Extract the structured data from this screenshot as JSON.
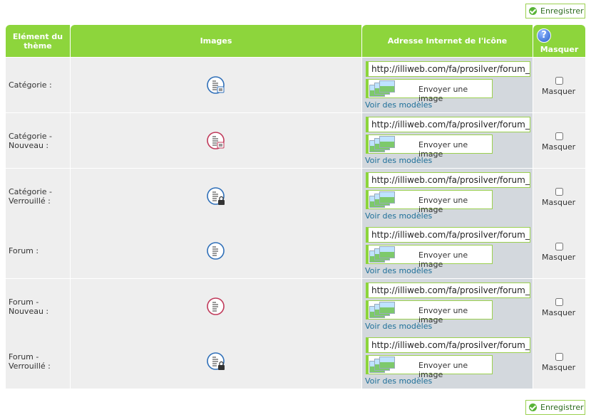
{
  "actions": {
    "save_label": "Enregistrer"
  },
  "headers": {
    "element": "Elément du thème",
    "images": "Images",
    "url": "Adresse Internet de l'icône",
    "hide": "Masquer"
  },
  "common": {
    "upload_label": "Envoyer une image",
    "models_link": "Voir des modèles",
    "hide_label": "Masquer"
  },
  "colors": {
    "header_bg": "#8dd53c",
    "blue_icon": "#2f6fb8",
    "red_icon": "#c0395a"
  },
  "rows": [
    {
      "label": "Catégorie :",
      "url": "http://illiweb.com/fa/prosilver/forum_read.gif",
      "icon": "category-read-icon",
      "tone": "blue",
      "badge": "page"
    },
    {
      "label": "Catégorie - Nouveau :",
      "url": "http://illiweb.com/fa/prosilver/forum_unread.gif",
      "icon": "category-new-icon",
      "tone": "red",
      "badge": "page"
    },
    {
      "label": "Catégorie - Verrouillé :",
      "url": "http://illiweb.com/fa/prosilver/forum_read_locked.gif",
      "icon": "category-locked-icon",
      "tone": "blue",
      "badge": "lock"
    },
    {
      "label": "Forum :",
      "url": "http://illiweb.com/fa/prosilver/forum_read.gif",
      "icon": "forum-read-icon",
      "tone": "blue",
      "badge": "none"
    },
    {
      "label": "Forum - Nouveau :",
      "url": "http://illiweb.com/fa/prosilver/forum_unread.gif",
      "icon": "forum-new-icon",
      "tone": "red",
      "badge": "none"
    },
    {
      "label": "Forum - Verrouillé :",
      "url": "http://illiweb.com/fa/prosilver/forum_read_locked.gif",
      "icon": "forum-locked-icon",
      "tone": "blue",
      "badge": "lock"
    }
  ]
}
